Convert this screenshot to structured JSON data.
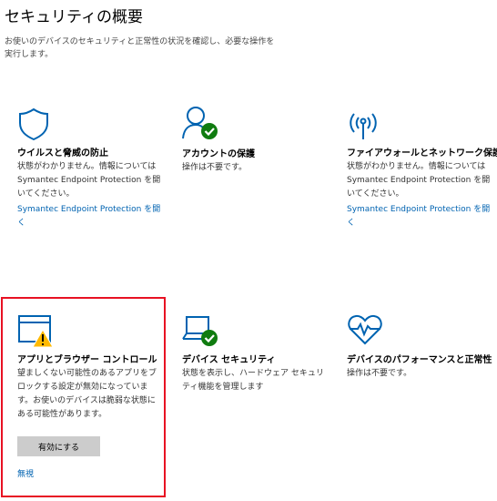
{
  "header": {
    "title": "セキュリティの概要",
    "subtitle": "お使いのデバイスのセキュリティと正常性の状況を確認し、必要な操作を実行します。"
  },
  "cards": [
    {
      "title": "ウイルスと脅威の防止",
      "desc": "状態がわかりません。情報については Symantec Endpoint Protection を開いてください。",
      "link": "Symantec Endpoint Protection を開く",
      "icon": "shield-icon"
    },
    {
      "title": "アカウントの保護",
      "desc": "操作は不要です。",
      "icon": "account-icon"
    },
    {
      "title": "ファイアウォールとネットワーク保護",
      "desc": "状態がわかりません。情報については Symantec Endpoint Protection を開いてください。",
      "link": "Symantec Endpoint Protection を開く",
      "icon": "wireless-antenna-icon"
    },
    {
      "title": "アプリとブラウザー コントロール",
      "desc": "望ましくない可能性のあるアプリをブロックする設定が無効になっています。お使いのデバイスは脆弱な状態にある可能性があります。",
      "button": "有効にする",
      "link": "無視",
      "icon": "app-browser-warning-icon"
    },
    {
      "title": "デバイス セキュリティ",
      "desc": "状態を表示し、ハードウェア セキュリティ機能を管理します",
      "icon": "laptop-icon"
    },
    {
      "title": "デバイスのパフォーマンスと正常性",
      "desc": "操作は不要です。",
      "icon": "heart-pulse-icon"
    }
  ],
  "colors": {
    "accent": "#0063b1",
    "ok": "#107c10",
    "warning": "#ffb900",
    "highlight": "#e81123"
  }
}
